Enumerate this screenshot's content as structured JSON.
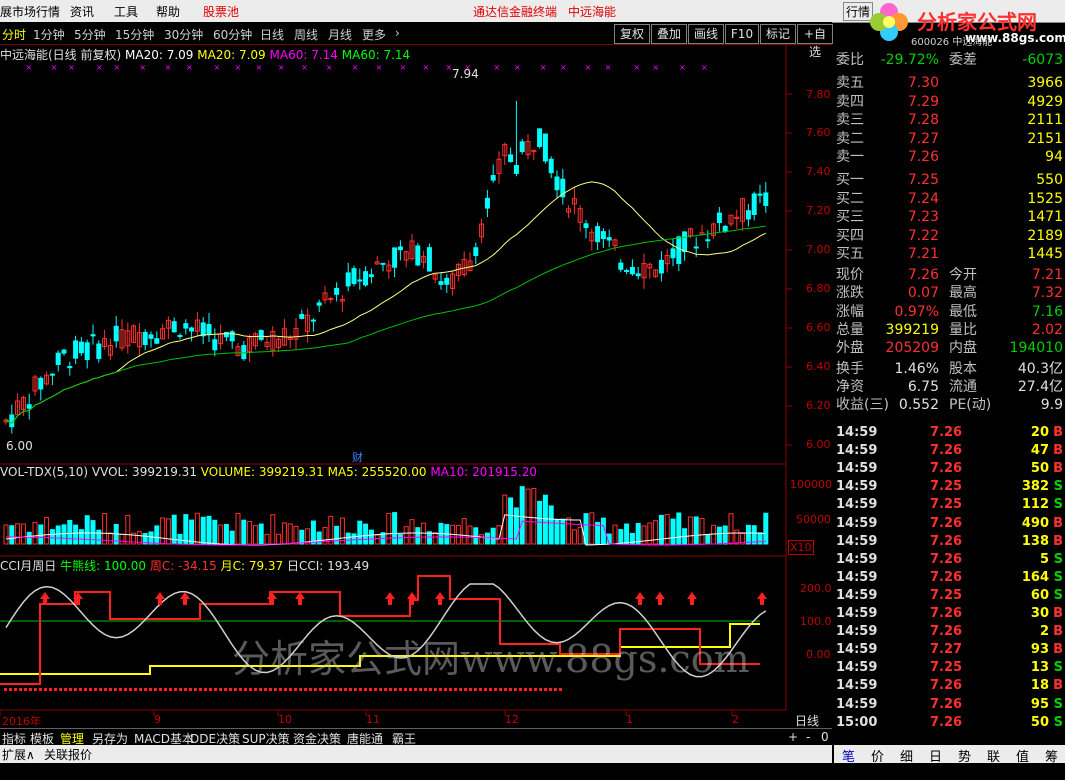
{
  "menubar": {
    "items": [
      "展市场行情",
      "资讯",
      "工具",
      "帮助",
      "股票池",
      "日线",
      "周线",
      "月线",
      "更多"
    ],
    "brand": "通达信金融终端",
    "stock": "中远海能",
    "right_btn": "行情"
  },
  "logo": {
    "text": "分析家公式网",
    "url": "www.88gs.com",
    "sub": "600026 中远海能"
  },
  "timebar": {
    "tabs": [
      "分时",
      "1分钟",
      "5分钟",
      "15分钟",
      "30分钟",
      "60分钟",
      "日线",
      "周线",
      "月线",
      "更多"
    ],
    "more_arrow": "›",
    "buttons": [
      "复权",
      "叠加",
      "画线",
      "F10",
      "标记",
      "+自选"
    ]
  },
  "legend1": {
    "title": "中远海能(日线 前复权)",
    "ma20a": "MA20: 7.09",
    "ma20b": "MA20: 7.09",
    "ma60a": "MA60: 7.14",
    "ma60b": "MA60: 7.14"
  },
  "price_axis": [
    "7.80",
    "7.60",
    "7.40",
    "7.20",
    "7.00",
    "6.80",
    "6.60",
    "6.40",
    "6.20",
    "6.00"
  ],
  "annotations": {
    "high": "7.94",
    "low": "6.00",
    "cai": "财"
  },
  "legend2": {
    "name": "VOL-TDX(5,10)",
    "vvol": "VVOL: 399219.31",
    "volume": "VOLUME: 399219.31",
    "ma5": "MA5: 255520.00",
    "ma10": "MA10: 201915.20"
  },
  "vol_axis": [
    "100000",
    "50000",
    "X10"
  ],
  "legend3": {
    "name": "CCI月周日",
    "niu": "牛熊线: 100.00",
    "zhou": "周C: -34.15",
    "yue": "月C: 79.37",
    "ri": "日CCI: 193.49"
  },
  "cci_axis": [
    "200.0",
    "100.0",
    "0.00"
  ],
  "watermark": "分析家公式网www.88gs.com",
  "date_axis": [
    "2016年",
    "9",
    "10",
    "11",
    "12",
    "1",
    "2"
  ],
  "period_label": "日线",
  "bottomtabs": [
    "指标",
    "模板",
    "管理",
    "另存为",
    "MACD基本",
    "DDE决策",
    "SUP决策",
    "资金决策",
    "唐能通",
    "霸王"
  ],
  "bottom_controls": [
    "+",
    "-",
    "0"
  ],
  "statusbar": {
    "expand": "扩展∧",
    "link": "关联报价"
  },
  "quote": {
    "weibi": {
      "label": "委比",
      "value": "-29.72%",
      "label2": "委差",
      "value2": "-6073"
    },
    "sells": [
      {
        "label": "卖五",
        "price": "7.30",
        "vol": "3966"
      },
      {
        "label": "卖四",
        "price": "7.29",
        "vol": "4929"
      },
      {
        "label": "卖三",
        "price": "7.28",
        "vol": "2111"
      },
      {
        "label": "卖二",
        "price": "7.27",
        "vol": "2151"
      },
      {
        "label": "卖一",
        "price": "7.26",
        "vol": "94"
      }
    ],
    "buys": [
      {
        "label": "买一",
        "price": "7.25",
        "vol": "550"
      },
      {
        "label": "买二",
        "price": "7.24",
        "vol": "1525"
      },
      {
        "label": "买三",
        "price": "7.23",
        "vol": "1471"
      },
      {
        "label": "买四",
        "price": "7.22",
        "vol": "2189"
      },
      {
        "label": "买五",
        "price": "7.21",
        "vol": "1445"
      }
    ],
    "stats": [
      {
        "l1": "现价",
        "v1": "7.26",
        "l2": "今开",
        "v2": "7.21"
      },
      {
        "l1": "涨跌",
        "v1": "0.07",
        "l2": "最高",
        "v2": "7.32"
      },
      {
        "l1": "涨幅",
        "v1": "0.97%",
        "l2": "最低",
        "v2": "7.16"
      },
      {
        "l1": "总量",
        "v1": "399219",
        "l2": "量比",
        "v2": "2.02"
      },
      {
        "l1": "外盘",
        "v1": "205209",
        "l2": "内盘",
        "v2": "194010"
      },
      {
        "l1": "换手",
        "v1": "1.46%",
        "l2": "股本",
        "v2": "40.3亿"
      },
      {
        "l1": "净资",
        "v1": "6.75",
        "l2": "流通",
        "v2": "27.4亿"
      },
      {
        "l1": "收益(三)",
        "v1": "0.552",
        "l2": "PE(动)",
        "v2": "9.9"
      }
    ],
    "ticks": [
      {
        "t": "14:59",
        "p": "7.26",
        "v": "20",
        "bs": "B"
      },
      {
        "t": "14:59",
        "p": "7.26",
        "v": "47",
        "bs": "B"
      },
      {
        "t": "14:59",
        "p": "7.26",
        "v": "50",
        "bs": "B"
      },
      {
        "t": "14:59",
        "p": "7.25",
        "v": "382",
        "bs": "S"
      },
      {
        "t": "14:59",
        "p": "7.25",
        "v": "112",
        "bs": "S"
      },
      {
        "t": "14:59",
        "p": "7.26",
        "v": "490",
        "bs": "B"
      },
      {
        "t": "14:59",
        "p": "7.26",
        "v": "138",
        "bs": "B"
      },
      {
        "t": "14:59",
        "p": "7.26",
        "v": "5",
        "bs": "S"
      },
      {
        "t": "14:59",
        "p": "7.26",
        "v": "164",
        "bs": "S"
      },
      {
        "t": "14:59",
        "p": "7.25",
        "v": "60",
        "bs": "S"
      },
      {
        "t": "14:59",
        "p": "7.26",
        "v": "30",
        "bs": "B"
      },
      {
        "t": "14:59",
        "p": "7.26",
        "v": "2",
        "bs": "B"
      },
      {
        "t": "14:59",
        "p": "7.27",
        "v": "93",
        "bs": "B"
      },
      {
        "t": "14:59",
        "p": "7.25",
        "v": "13",
        "bs": "S"
      },
      {
        "t": "14:59",
        "p": "7.26",
        "v": "18",
        "bs": "B"
      },
      {
        "t": "14:59",
        "p": "7.26",
        "v": "95",
        "bs": "S"
      },
      {
        "t": "15:00",
        "p": "7.26",
        "v": "50",
        "bs": "S"
      }
    ],
    "tabs": [
      "笔",
      "价",
      "细",
      "日",
      "势",
      "联",
      "值",
      "筹"
    ]
  },
  "colors": {
    "up": "#ff3030",
    "down": "#00ffff",
    "ma20": "#ffff80",
    "ma60": "#00c000",
    "frame": "#8b0000"
  }
}
